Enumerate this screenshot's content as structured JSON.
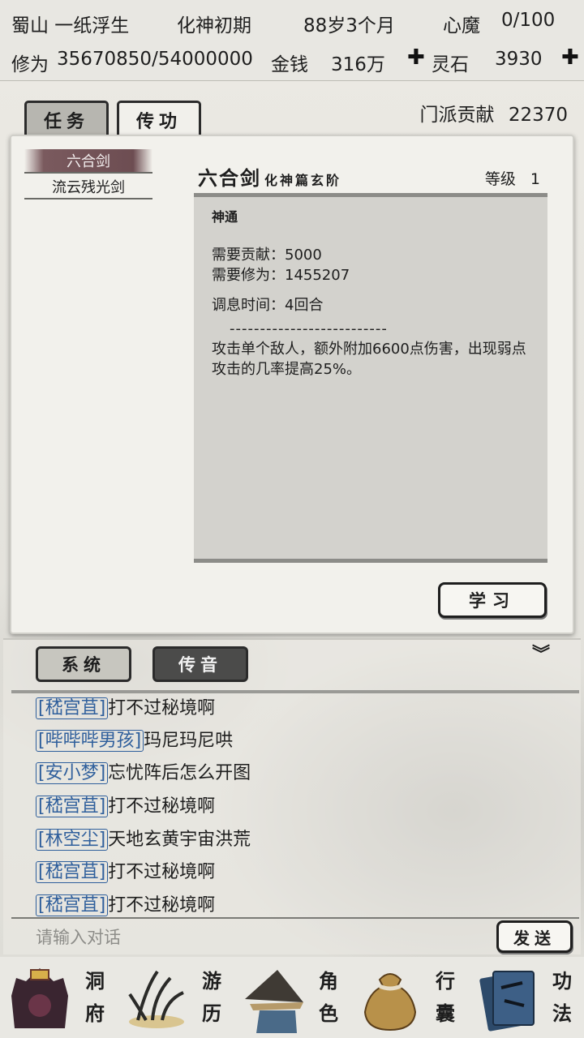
{
  "status": {
    "sect_name": "蜀山 一纸浮生",
    "realm": "化神初期",
    "age": "88岁3个月",
    "heart_demon_label": "心魔",
    "heart_demon_value": "0/100",
    "cultivation_label": "修为",
    "cultivation_value": "35670850/54000000",
    "money_label": "金钱",
    "money_value": "316万",
    "spirit_stone_label": "灵石",
    "spirit_stone_value": "3930",
    "plus_glyph": "✚"
  },
  "tabs": {
    "task": "任务",
    "transmit": "传功"
  },
  "contribution": {
    "label": "门派贡献",
    "value": "22370"
  },
  "skills_list": [
    {
      "label": "六合剑"
    },
    {
      "label": "流云残光剑"
    }
  ],
  "skill_detail": {
    "name": "六合剑",
    "tag": "化神篇玄阶",
    "level_label": "等级",
    "level_value": "1",
    "kind": "神通",
    "req_contribution": "需要贡献：5000",
    "req_cultivation": "需要修为：1455207",
    "cooldown": "调息时间：4回合",
    "divider": "--------------------------",
    "description": "攻击单个敌人，额外附加6600点伤害，出现弱点攻击的几率提高25%。",
    "learn_button": "学习"
  },
  "chat": {
    "tab_system": "系统",
    "tab_whisper": "传音",
    "collapse_glyph": "︾",
    "messages": [
      {
        "user": "[嵇宫苴]",
        "text": "打不过秘境啊"
      },
      {
        "user": "[哔哔哔男孩]",
        "text": "玛尼玛尼哄"
      },
      {
        "user": "[安小梦]",
        "text": "忘忧阵后怎么开图"
      },
      {
        "user": "[嵇宫苴]",
        "text": "打不过秘境啊"
      },
      {
        "user": "[林空尘]",
        "text": "天地玄黄宇宙洪荒"
      },
      {
        "user": "[嵇宫苴]",
        "text": "打不过秘境啊"
      },
      {
        "user": "[嵇宫苴]",
        "text": "打不过秘境啊"
      }
    ],
    "input_placeholder": "请输入对话",
    "send_button": "发送"
  },
  "nav": [
    {
      "label": "洞府",
      "icon": "cave-dwelling-icon"
    },
    {
      "label": "游历",
      "icon": "travel-grass-icon"
    },
    {
      "label": "角色",
      "icon": "character-hat-icon"
    },
    {
      "label": "行囊",
      "icon": "bag-icon"
    },
    {
      "label": "功法",
      "icon": "scroll-books-icon"
    }
  ]
}
